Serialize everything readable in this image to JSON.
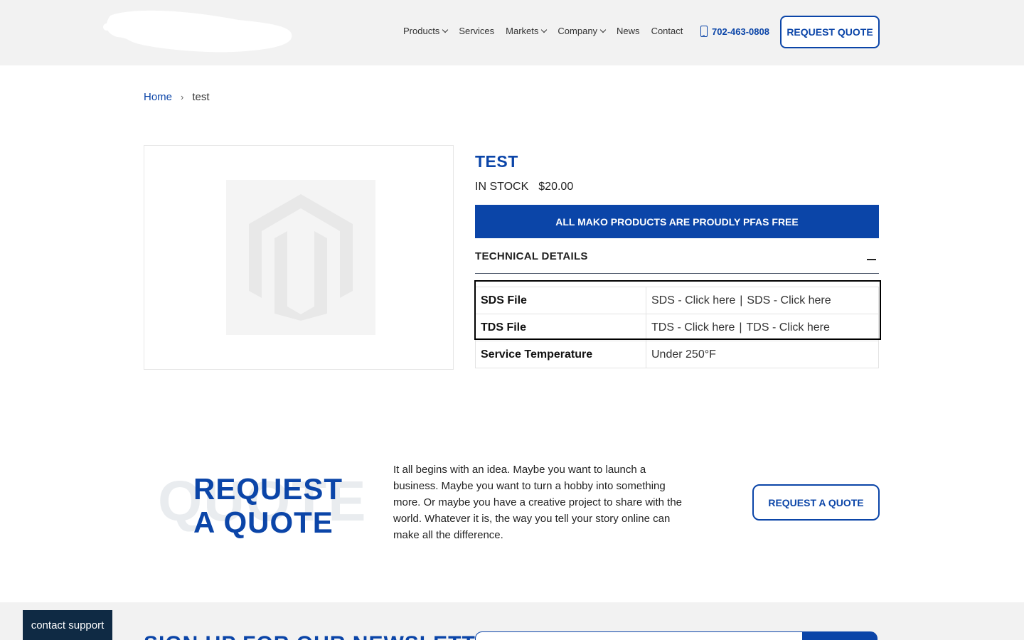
{
  "header": {
    "nav": [
      {
        "label": "Products",
        "dropdown": true
      },
      {
        "label": "Services",
        "dropdown": false
      },
      {
        "label": "Markets",
        "dropdown": true
      },
      {
        "label": "Company",
        "dropdown": true
      },
      {
        "label": "News",
        "dropdown": false
      },
      {
        "label": "Contact",
        "dropdown": false
      }
    ],
    "phone": "702-463-0808",
    "request_quote_label": "REQUEST QUOTE"
  },
  "breadcrumb": {
    "home": "Home",
    "separator": "›",
    "current": "test"
  },
  "product": {
    "title": "TEST",
    "stock": "IN STOCK",
    "price": "$20.00",
    "banner": "ALL MAKO PRODUCTS ARE PROUDLY PFAS FREE",
    "tech_details_title": "TECHNICAL DETAILS",
    "tech_rows": [
      {
        "label": "SDS File",
        "links": [
          "SDS - Click here",
          "SDS - Click here"
        ],
        "separator": "|"
      },
      {
        "label": "TDS File",
        "links": [
          "TDS - Click here",
          "TDS - Click here"
        ],
        "separator": "|"
      },
      {
        "label": "Service Temperature",
        "value": "Under 250°F"
      }
    ]
  },
  "request_quote": {
    "bg_word": "QUOTE",
    "title_line1": "REQUEST",
    "title_line2": "A QUOTE",
    "text": "It all begins with an idea. Maybe you want to launch a business. Maybe you want to turn a hobby into something more. Or maybe you have a creative project to share with the world. Whatever it is, the way you tell your story online can make all the difference.",
    "button_label": "REQUEST A QUOTE"
  },
  "footer": {
    "newsletter_title": "SIGN UP FOR OUR NEWSLETTER"
  },
  "contact_support_label": "contact support",
  "colors": {
    "brand_blue": "#0b45a8",
    "header_bg": "#f2f2f2",
    "support_bg": "#0f2a44"
  }
}
